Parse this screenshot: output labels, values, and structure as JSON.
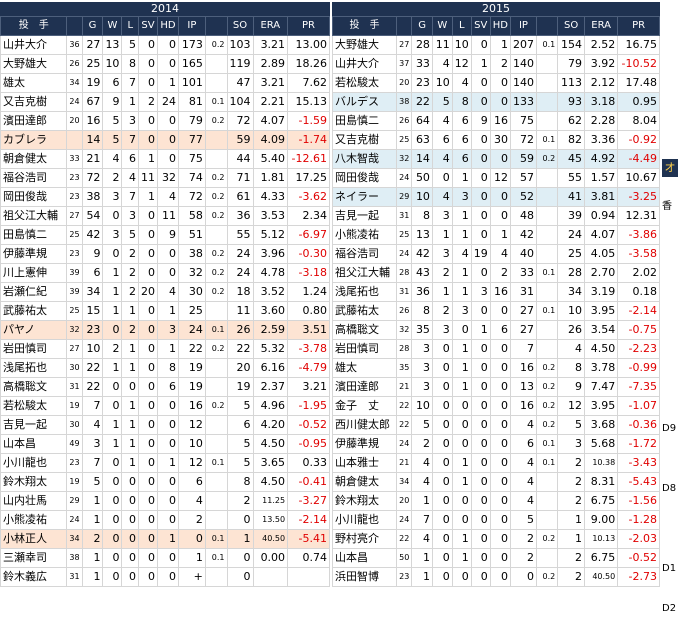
{
  "y2014": {
    "year": "2014",
    "headers": [
      "投　手",
      "",
      "G",
      "W",
      "L",
      "SV",
      "HD",
      "IP",
      "",
      "SO",
      "ERA",
      "PR"
    ],
    "rows": [
      [
        "山井大介",
        "36",
        "27",
        "13",
        "5",
        "0",
        "0",
        "173",
        "0.2",
        "103",
        "3.21",
        "13.00",
        ""
      ],
      [
        "大野雄大",
        "26",
        "25",
        "10",
        "8",
        "0",
        "0",
        "165",
        "",
        "119",
        "2.89",
        "18.26",
        ""
      ],
      [
        "雄太",
        "34",
        "19",
        "6",
        "7",
        "0",
        "1",
        "101",
        "",
        "47",
        "3.21",
        "7.62",
        ""
      ],
      [
        "又吉克樹",
        "24",
        "67",
        "9",
        "1",
        "2",
        "24",
        "81",
        "0.1",
        "104",
        "2.21",
        "15.13",
        ""
      ],
      [
        "濱田達郎",
        "20",
        "16",
        "5",
        "3",
        "0",
        "0",
        "79",
        "0.2",
        "72",
        "4.07",
        "-1.59",
        ""
      ],
      [
        "カブレラ",
        "",
        "14",
        "5",
        "7",
        "0",
        "0",
        "77",
        "",
        "59",
        "4.09",
        "-1.74",
        "peach"
      ],
      [
        "朝倉健太",
        "33",
        "21",
        "4",
        "6",
        "1",
        "0",
        "75",
        "",
        "44",
        "5.40",
        "-12.61",
        ""
      ],
      [
        "福谷浩司",
        "23",
        "72",
        "2",
        "4",
        "11",
        "32",
        "74",
        "0.2",
        "71",
        "1.81",
        "17.25",
        ""
      ],
      [
        "岡田俊哉",
        "23",
        "38",
        "3",
        "7",
        "1",
        "4",
        "72",
        "0.2",
        "61",
        "4.33",
        "-3.62",
        ""
      ],
      [
        "祖父江大輔",
        "27",
        "54",
        "0",
        "3",
        "0",
        "11",
        "58",
        "0.2",
        "36",
        "3.53",
        "2.34",
        ""
      ],
      [
        "田島慎二",
        "25",
        "42",
        "3",
        "5",
        "0",
        "9",
        "51",
        "",
        "55",
        "5.12",
        "-6.97",
        ""
      ],
      [
        "伊藤準規",
        "23",
        "9",
        "0",
        "2",
        "0",
        "0",
        "38",
        "0.2",
        "24",
        "3.96",
        "-0.30",
        ""
      ],
      [
        "川上憲伸",
        "39",
        "6",
        "1",
        "2",
        "0",
        "0",
        "32",
        "0.2",
        "24",
        "4.78",
        "-3.18",
        ""
      ],
      [
        "岩瀬仁紀",
        "39",
        "34",
        "1",
        "2",
        "20",
        "4",
        "30",
        "0.2",
        "18",
        "3.52",
        "1.24",
        ""
      ],
      [
        "武藤祐太",
        "25",
        "15",
        "1",
        "1",
        "0",
        "1",
        "25",
        "",
        "11",
        "3.60",
        "0.80",
        ""
      ],
      [
        "パヤノ",
        "32",
        "23",
        "0",
        "2",
        "0",
        "3",
        "24",
        "0.1",
        "26",
        "2.59",
        "3.51",
        "peach"
      ],
      [
        "岩田慎司",
        "27",
        "10",
        "2",
        "1",
        "0",
        "1",
        "22",
        "0.2",
        "22",
        "5.32",
        "-3.78",
        ""
      ],
      [
        "浅尾拓也",
        "30",
        "22",
        "1",
        "1",
        "0",
        "8",
        "19",
        "",
        "20",
        "6.16",
        "-4.79",
        ""
      ],
      [
        "高橋聡文",
        "31",
        "22",
        "0",
        "0",
        "0",
        "6",
        "19",
        "",
        "19",
        "2.37",
        "3.21",
        ""
      ],
      [
        "若松駿太",
        "19",
        "7",
        "0",
        "1",
        "0",
        "0",
        "16",
        "0.2",
        "5",
        "4.96",
        "-1.95",
        ""
      ],
      [
        "吉見一起",
        "30",
        "4",
        "1",
        "1",
        "0",
        "0",
        "12",
        "",
        "6",
        "4.20",
        "-0.52",
        ""
      ],
      [
        "山本昌",
        "49",
        "3",
        "1",
        "1",
        "0",
        "0",
        "10",
        "",
        "5",
        "4.50",
        "-0.95",
        ""
      ],
      [
        "小川龍也",
        "23",
        "7",
        "0",
        "1",
        "0",
        "1",
        "12",
        "0.1",
        "5",
        "3.65",
        "0.33",
        ""
      ],
      [
        "鈴木翔太",
        "19",
        "5",
        "0",
        "0",
        "0",
        "0",
        "6",
        "",
        "8",
        "4.50",
        "-0.41",
        ""
      ],
      [
        "山内壮馬",
        "29",
        "1",
        "0",
        "0",
        "0",
        "0",
        "4",
        "",
        "2",
        "11.25",
        "-3.27",
        ""
      ],
      [
        "小熊凌祐",
        "24",
        "1",
        "0",
        "0",
        "0",
        "0",
        "2",
        "",
        "0",
        "13.50",
        "-2.14",
        ""
      ],
      [
        "小林正人",
        "34",
        "2",
        "0",
        "0",
        "0",
        "1",
        "0",
        "0.1",
        "1",
        "40.50",
        "-5.41",
        "peach"
      ],
      [
        "三瀬幸司",
        "38",
        "1",
        "0",
        "0",
        "0",
        "0",
        "1",
        "0.1",
        "0",
        "0.00",
        "0.74",
        ""
      ],
      [
        "鈴木義広",
        "31",
        "1",
        "0",
        "0",
        "0",
        "0",
        "+",
        "",
        "0",
        "",
        "",
        ""
      ]
    ]
  },
  "y2015": {
    "year": "2015",
    "headers": [
      "投　手",
      "",
      "G",
      "W",
      "L",
      "SV",
      "HD",
      "IP",
      "",
      "SO",
      "ERA",
      "PR"
    ],
    "rows": [
      [
        "大野雄大",
        "27",
        "28",
        "11",
        "10",
        "0",
        "1",
        "207",
        "0.1",
        "154",
        "2.52",
        "16.75",
        ""
      ],
      [
        "山井大介",
        "37",
        "33",
        "4",
        "12",
        "1",
        "2",
        "140",
        "",
        "79",
        "3.92",
        "-10.52",
        ""
      ],
      [
        "若松駿太",
        "20",
        "23",
        "10",
        "4",
        "0",
        "0",
        "140",
        "",
        "113",
        "2.12",
        "17.48",
        ""
      ],
      [
        "バルデス",
        "38",
        "22",
        "5",
        "8",
        "0",
        "0",
        "133",
        "",
        "93",
        "3.18",
        "0.95",
        "blue"
      ],
      [
        "田島慎二",
        "26",
        "64",
        "4",
        "6",
        "9",
        "16",
        "75",
        "",
        "62",
        "2.28",
        "8.04",
        ""
      ],
      [
        "又吉克樹",
        "25",
        "63",
        "6",
        "6",
        "0",
        "30",
        "72",
        "0.1",
        "82",
        "3.36",
        "-0.92",
        ""
      ],
      [
        "八木智哉",
        "32",
        "14",
        "4",
        "6",
        "0",
        "0",
        "59",
        "0.2",
        "45",
        "4.92",
        "-4.49",
        "blue"
      ],
      [
        "岡田俊哉",
        "24",
        "50",
        "0",
        "1",
        "0",
        "12",
        "57",
        "",
        "55",
        "1.57",
        "10.67",
        ""
      ],
      [
        "ネイラー",
        "29",
        "10",
        "4",
        "3",
        "0",
        "0",
        "52",
        "",
        "41",
        "3.81",
        "-3.25",
        "blue"
      ],
      [
        "吉見一起",
        "31",
        "8",
        "3",
        "1",
        "0",
        "0",
        "48",
        "",
        "39",
        "0.94",
        "12.31",
        ""
      ],
      [
        "小熊凌祐",
        "25",
        "13",
        "1",
        "1",
        "0",
        "1",
        "42",
        "",
        "24",
        "4.07",
        "-3.86",
        ""
      ],
      [
        "福谷浩司",
        "24",
        "42",
        "3",
        "4",
        "19",
        "4",
        "40",
        "",
        "25",
        "4.05",
        "-3.58",
        ""
      ],
      [
        "祖父江大輔",
        "28",
        "43",
        "2",
        "1",
        "0",
        "2",
        "33",
        "0.1",
        "28",
        "2.70",
        "2.02",
        ""
      ],
      [
        "浅尾拓也",
        "31",
        "36",
        "1",
        "1",
        "3",
        "16",
        "31",
        "",
        "34",
        "3.19",
        "0.18",
        ""
      ],
      [
        "武藤祐太",
        "26",
        "8",
        "2",
        "3",
        "0",
        "0",
        "27",
        "0.1",
        "10",
        "3.95",
        "-2.14",
        ""
      ],
      [
        "高橋聡文",
        "32",
        "35",
        "3",
        "0",
        "1",
        "6",
        "27",
        "",
        "26",
        "3.54",
        "-0.75",
        ""
      ],
      [
        "岩田慎司",
        "28",
        "3",
        "0",
        "1",
        "0",
        "0",
        "7",
        "",
        "4",
        "4.50",
        "-2.23",
        ""
      ],
      [
        "雄太",
        "35",
        "3",
        "0",
        "1",
        "0",
        "0",
        "16",
        "0.2",
        "8",
        "3.78",
        "-0.99",
        ""
      ],
      [
        "濱田達郎",
        "21",
        "3",
        "0",
        "1",
        "0",
        "0",
        "13",
        "0.2",
        "9",
        "7.47",
        "-7.35",
        ""
      ],
      [
        "金子　丈",
        "22",
        "10",
        "0",
        "0",
        "0",
        "0",
        "16",
        "0.2",
        "12",
        "3.95",
        "-1.07",
        "gray"
      ],
      [
        "西川健太郎",
        "22",
        "5",
        "0",
        "0",
        "0",
        "0",
        "4",
        "0.2",
        "5",
        "3.68",
        "-0.36",
        ""
      ],
      [
        "伊藤準規",
        "24",
        "2",
        "0",
        "0",
        "0",
        "0",
        "6",
        "0.1",
        "3",
        "5.68",
        "-1.72",
        ""
      ],
      [
        "山本雅士",
        "21",
        "4",
        "0",
        "1",
        "0",
        "0",
        "4",
        "0.1",
        "2",
        "10.38",
        "-3.43",
        "gray"
      ],
      [
        "朝倉健太",
        "34",
        "4",
        "0",
        "1",
        "0",
        "0",
        "4",
        "",
        "2",
        "8.31",
        "-5.43",
        ""
      ],
      [
        "鈴木翔太",
        "20",
        "1",
        "0",
        "0",
        "0",
        "0",
        "4",
        "",
        "2",
        "6.75",
        "-1.56",
        ""
      ],
      [
        "小川龍也",
        "24",
        "7",
        "0",
        "0",
        "0",
        "0",
        "5",
        "",
        "1",
        "9.00",
        "-1.28",
        ""
      ],
      [
        "野村亮介",
        "22",
        "4",
        "0",
        "1",
        "0",
        "0",
        "2",
        "0.2",
        "1",
        "10.13",
        "-2.03",
        "gray"
      ],
      [
        "山本昌",
        "50",
        "1",
        "0",
        "1",
        "0",
        "0",
        "2",
        "",
        "2",
        "6.75",
        "-0.52",
        ""
      ],
      [
        "浜田智博",
        "23",
        "1",
        "0",
        "0",
        "0",
        "0",
        "0",
        "0.2",
        "2",
        "40.50",
        "-2.73",
        "gray"
      ]
    ]
  },
  "side_marks": {
    "mark": "オ",
    "kanji": "香",
    "d9": "D9",
    "d8": "D8",
    "d1": "D1",
    "d2": "D2"
  }
}
